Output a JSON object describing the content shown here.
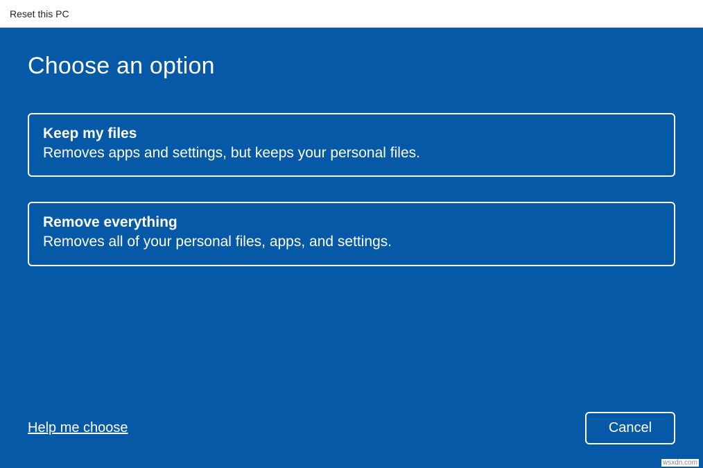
{
  "window": {
    "title": "Reset this PC"
  },
  "heading": "Choose an option",
  "options": [
    {
      "title": "Keep my files",
      "description": "Removes apps and settings, but keeps your personal files."
    },
    {
      "title": "Remove everything",
      "description": "Removes all of your personal files, apps, and settings."
    }
  ],
  "footer": {
    "help_link": "Help me choose",
    "cancel_label": "Cancel"
  },
  "watermark": "wsxdn.com"
}
